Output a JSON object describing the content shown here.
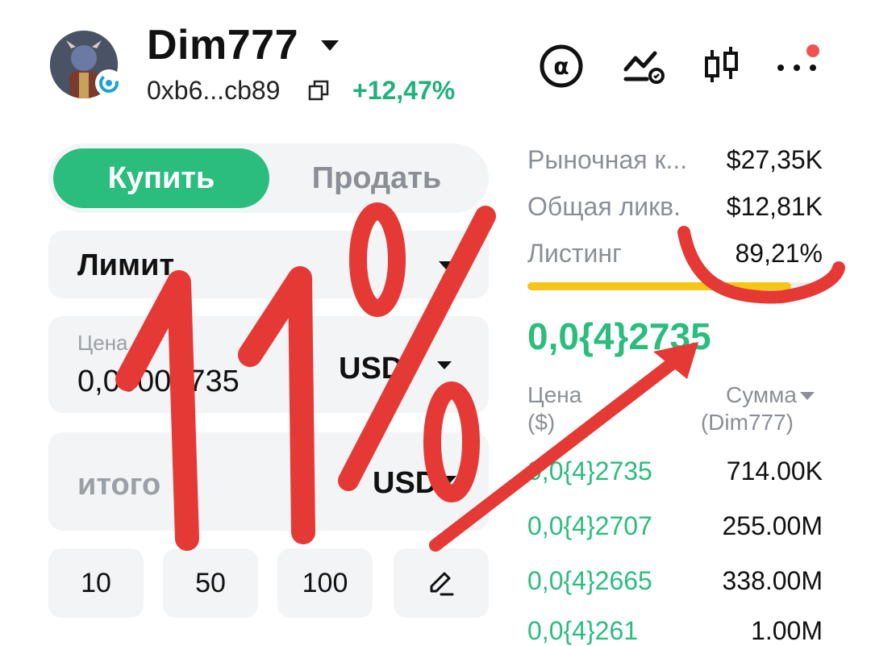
{
  "header": {
    "token_name": "Dim777",
    "address": "0xb6...cb89",
    "change": "+12,47%"
  },
  "icons": {
    "at": "at-sign-icon",
    "chart": "trend-chart-icon",
    "candles": "candlestick-icon",
    "more": "more-dots-icon"
  },
  "trade": {
    "buy_label": "Купить",
    "sell_label": "Продать",
    "order_type": "Лимит",
    "price_label": "Цена",
    "price_value": "0,00002735",
    "price_currency": "USD",
    "total_label": "итого",
    "total_currency": "USD",
    "chips": [
      "10",
      "50",
      "100"
    ]
  },
  "stats": [
    {
      "label": "Рыночная к...",
      "value": "$27,35K"
    },
    {
      "label": "Общая ликв.",
      "value": "$12,81K"
    },
    {
      "label": "Листинг",
      "value": "89,21%"
    }
  ],
  "listing_progress": 0.8921,
  "current_price": "0,0{4}2735",
  "orderbook": {
    "price_header": "Цена",
    "price_unit": "($)",
    "amount_header": "Сумма",
    "amount_unit": "(Dim777)",
    "rows": [
      {
        "price": "0,0{4}2735",
        "amount": "714.00K"
      },
      {
        "price": "0,0{4}2707",
        "amount": "255.00M"
      },
      {
        "price": "0,0{4}2665",
        "amount": "338.00M"
      },
      {
        "price": "0,0{4}261",
        "amount": "1.00M"
      }
    ]
  },
  "annotation": {
    "text": "11%"
  },
  "colors": {
    "accent_green": "#2bbd7e",
    "annotation_red": "#e53935",
    "progress_yellow": "#f5c518"
  }
}
